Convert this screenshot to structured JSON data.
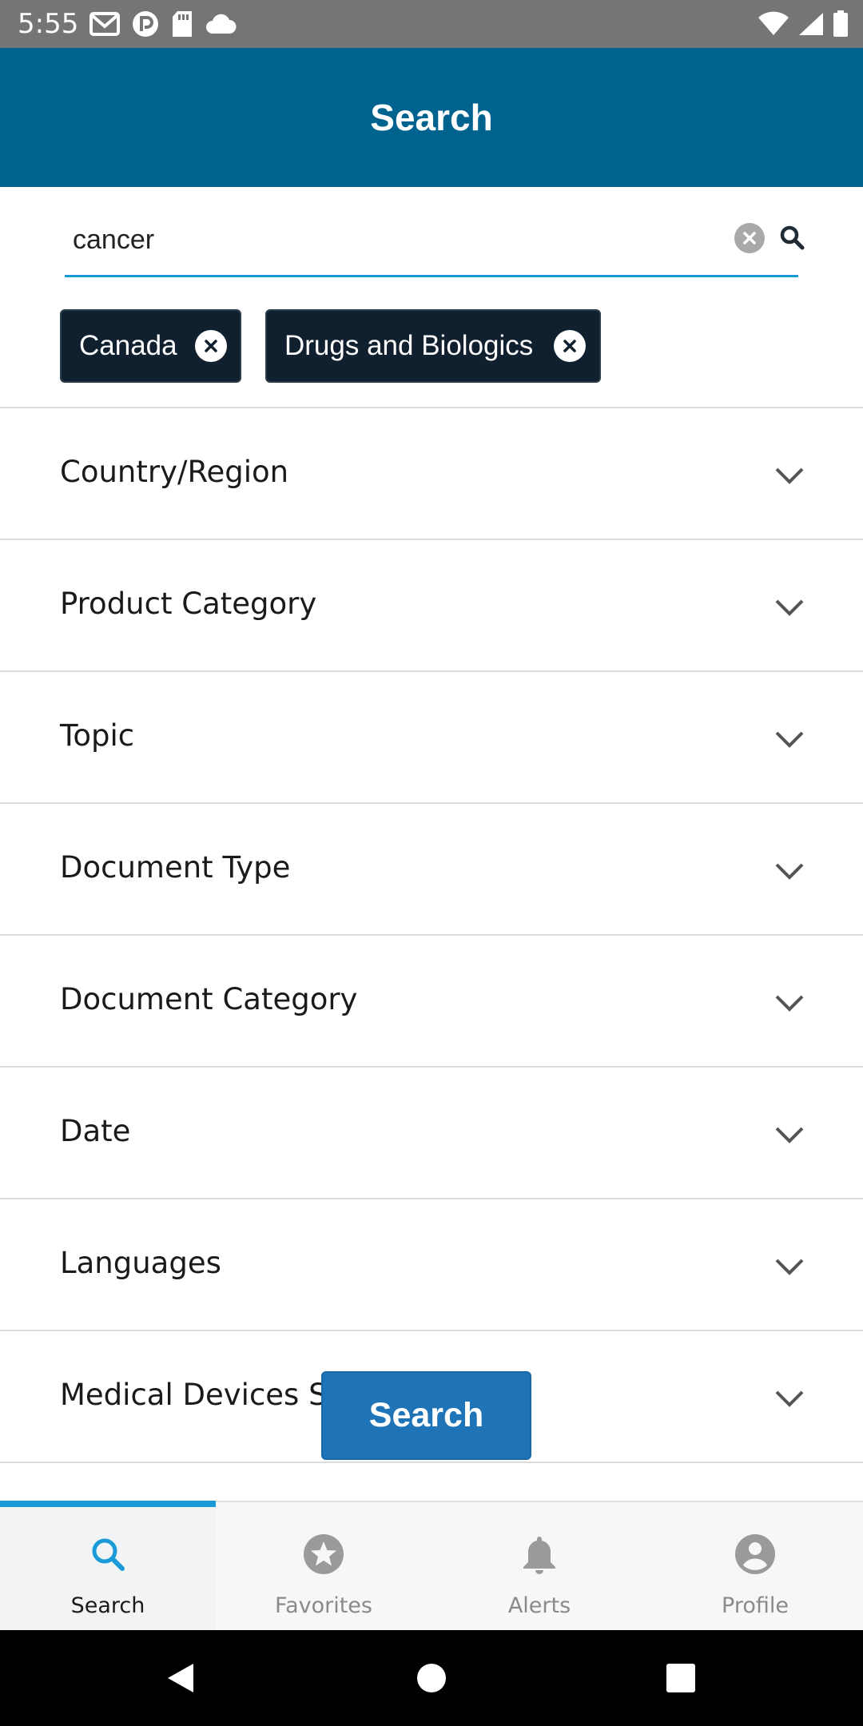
{
  "status_bar": {
    "time": "5:55",
    "left_icons": [
      "gmail-icon",
      "pocket-casts-icon",
      "sd-card-icon",
      "cloud-icon"
    ],
    "right_icons": [
      "wifi-icon",
      "signal-icon",
      "battery-icon"
    ]
  },
  "header": {
    "title": "Search"
  },
  "search": {
    "value": "cancer",
    "placeholder": "",
    "accent_color": "#1a9ad6"
  },
  "chips": [
    {
      "label": "Canada"
    },
    {
      "label": "Drugs and Biologics"
    }
  ],
  "filters": [
    {
      "label": "Country/Region"
    },
    {
      "label": "Product Category"
    },
    {
      "label": "Topic"
    },
    {
      "label": "Document Type"
    },
    {
      "label": "Document Category"
    },
    {
      "label": "Date"
    },
    {
      "label": "Languages"
    },
    {
      "label": "Medical Devices Spe"
    }
  ],
  "search_button": {
    "label": "Search",
    "color": "#1f74b8"
  },
  "bottom_nav": {
    "active": "Search",
    "tabs": [
      {
        "label": "Search",
        "icon": "search-icon"
      },
      {
        "label": "Favorites",
        "icon": "star-icon"
      },
      {
        "label": "Alerts",
        "icon": "bell-icon"
      },
      {
        "label": "Profile",
        "icon": "person-icon"
      }
    ]
  },
  "colors": {
    "header_bg": "#00628f",
    "chip_bg": "#10202e",
    "status_bar_bg": "#757575"
  }
}
